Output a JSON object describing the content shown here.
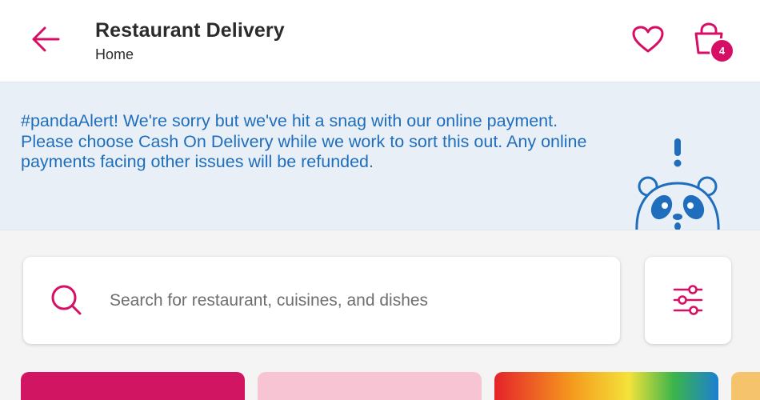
{
  "header": {
    "title": "Restaurant Delivery",
    "subtitle": "Home",
    "back_icon": "arrow-left-icon",
    "favorites_icon": "heart-icon",
    "cart_icon": "shopping-bag-icon",
    "cart_count": "4"
  },
  "alert": {
    "message": "#pandaAlert! We're sorry but we've hit a snag with our online payment. Please choose Cash On Delivery while we work to sort this out. Any online payments facing other issues will be refunded.",
    "illustration": "panda-alert-illustration"
  },
  "search": {
    "placeholder": "Search for restaurant, cuisines, and dishes",
    "value": "",
    "icon": "search-icon",
    "filter_icon": "sliders-icon"
  },
  "colors": {
    "brand": "#d70f64",
    "alert_text": "#1f6ebd",
    "alert_bg": "#e9eff6"
  }
}
